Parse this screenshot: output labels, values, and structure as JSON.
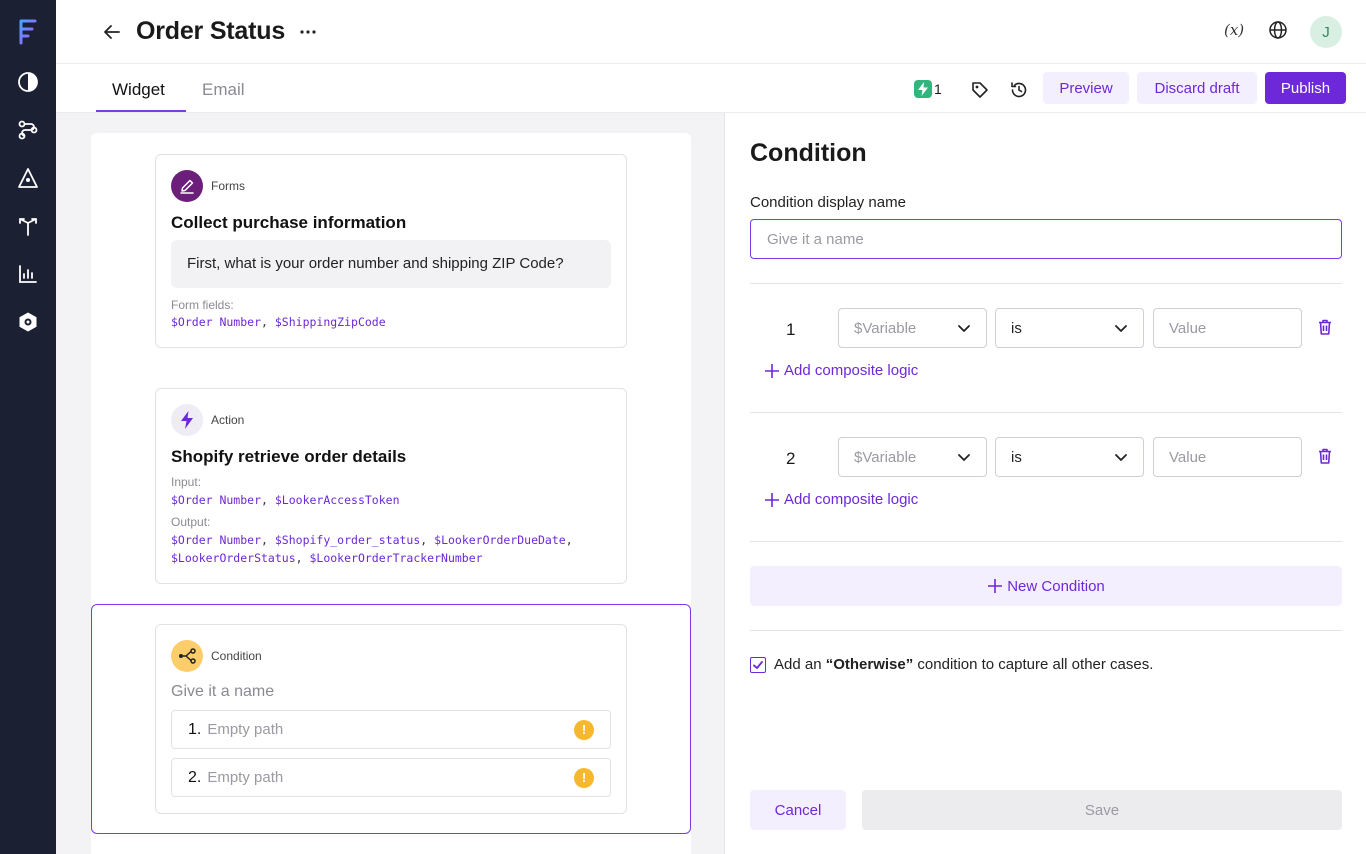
{
  "header": {
    "title": "Order Status",
    "variables_label": "(x)",
    "avatar_initial": "J"
  },
  "tabs": [
    {
      "label": "Widget",
      "active": true
    },
    {
      "label": "Email",
      "active": false
    }
  ],
  "toolbar": {
    "actions_count": "1",
    "preview_label": "Preview",
    "discard_label": "Discard draft",
    "publish_label": "Publish"
  },
  "canvas": {
    "forms_card": {
      "type_label": "Forms",
      "title": "Collect purchase information",
      "prompt": "First, what is your order number and shipping ZIP Code?",
      "fields_label": "Form fields:",
      "fields": [
        "$Order Number",
        "$ShippingZipCode"
      ]
    },
    "action_card": {
      "type_label": "Action",
      "title": "Shopify retrieve order details",
      "input_label": "Input:",
      "inputs": [
        "$Order Number",
        "$LookerAccessToken"
      ],
      "output_label": "Output:",
      "outputs_line1": [
        "$Order Number",
        "$Shopify_order_status",
        "$LookerOrderDueDate"
      ],
      "outputs_line2": [
        "$LookerOrderStatus",
        "$LookerOrderTrackerNumber"
      ]
    },
    "condition_card": {
      "type_label": "Condition",
      "name_placeholder": "Give it a name",
      "paths": [
        {
          "num": "1.",
          "label": "Empty path"
        },
        {
          "num": "2.",
          "label": "Empty path"
        }
      ]
    }
  },
  "panel": {
    "title": "Condition",
    "display_name_label": "Condition display name",
    "display_name_placeholder": "Give it a name",
    "conditions": [
      {
        "num": "1",
        "variable_placeholder": "$Variable",
        "operator": "is",
        "value_placeholder": "Value",
        "add_logic_label": "Add composite logic"
      },
      {
        "num": "2",
        "variable_placeholder": "$Variable",
        "operator": "is",
        "value_placeholder": "Value",
        "add_logic_label": "Add composite logic"
      }
    ],
    "new_condition_label": "New Condition",
    "otherwise": {
      "checked": true,
      "prefix": "Add an ",
      "keyword": "“Otherwise”",
      "suffix": " condition to capture all other cases."
    },
    "cancel_label": "Cancel",
    "save_label": "Save"
  },
  "colors": {
    "accent": "#6d28d9",
    "sidebar_bg": "#1c2033",
    "forms_icon_bg": "#6b1f7a",
    "action_icon_bg": "#efecf6",
    "condition_icon_bg": "#fdcd6b",
    "warning": "#f5b82e",
    "bolt_badge": "#2fb67c"
  }
}
